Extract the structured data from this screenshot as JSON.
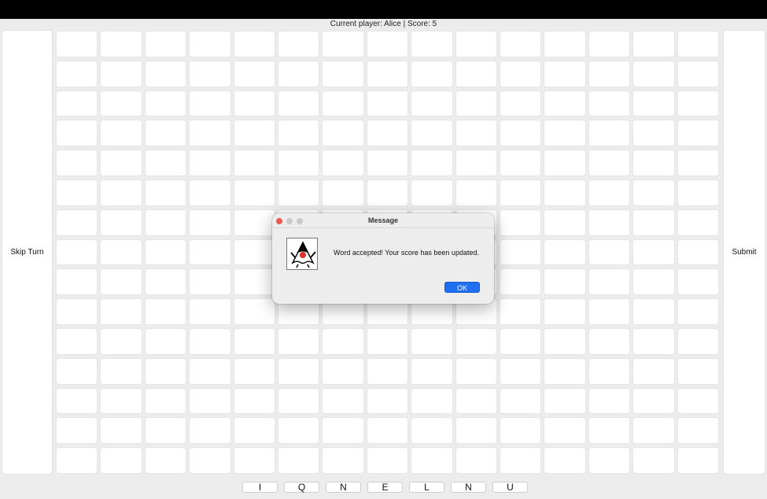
{
  "status": {
    "text": "Current player: Alice | Score: 5"
  },
  "controls": {
    "skip_label": "Skip Turn",
    "submit_label": "Submit"
  },
  "board": {
    "rows": 15,
    "cols": 15
  },
  "rack": [
    "I",
    "Q",
    "N",
    "E",
    "L",
    "N",
    "U"
  ],
  "dialog": {
    "title": "Message",
    "message": "Word accepted! Your score has been updated.",
    "ok_label": "OK",
    "icon": "java-duke-icon"
  },
  "colors": {
    "accent": "#1f6ff1",
    "close_light": "#ee5a52"
  }
}
